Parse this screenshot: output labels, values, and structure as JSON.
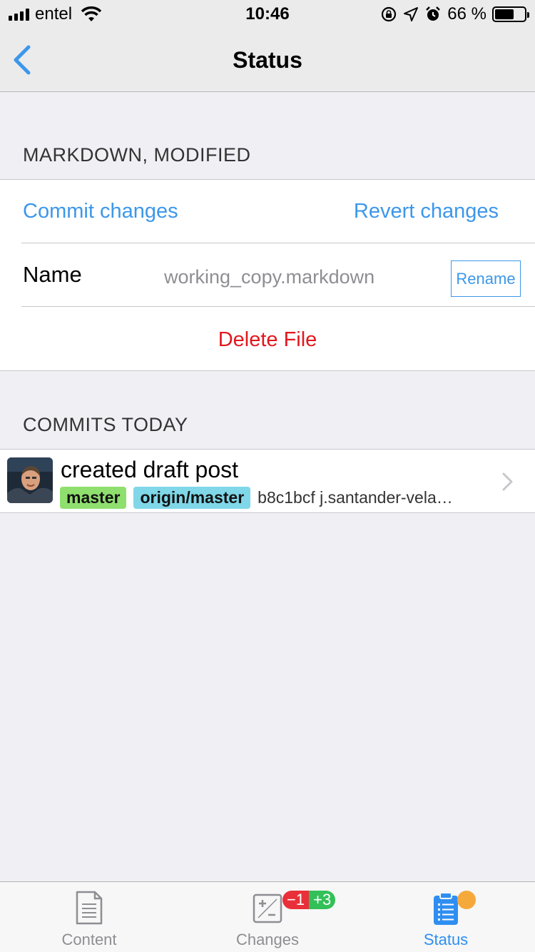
{
  "status_bar": {
    "carrier": "entel",
    "time": "10:46",
    "battery_text": "66 %",
    "battery_level": 0.66
  },
  "nav": {
    "title": "Status"
  },
  "file_section": {
    "header": "MARKDOWN, MODIFIED",
    "commit_label": "Commit changes",
    "revert_label": "Revert changes",
    "name_label": "Name",
    "name_value": "working_copy.markdown",
    "rename_label": "Rename",
    "delete_label": "Delete File"
  },
  "commits_section": {
    "header": "COMMITS TODAY",
    "commits": [
      {
        "title": "created draft post",
        "branch_tags": [
          "master",
          "origin/master"
        ],
        "meta": "b8c1bcf j.santander-vela…"
      }
    ]
  },
  "tabbar": {
    "tabs": [
      {
        "label": "Content",
        "icon": "document-icon",
        "active": false
      },
      {
        "label": "Changes",
        "icon": "diff-icon",
        "active": false,
        "badge_minus": "−1",
        "badge_plus": "+3"
      },
      {
        "label": "Status",
        "icon": "clipboard-list-icon",
        "active": true
      }
    ]
  },
  "colors": {
    "accent": "#3c97ea",
    "destructive": "#e3171e",
    "tag_master": "#8fdf6e",
    "tag_origin": "#7fd7e8",
    "badge_minus": "#e9303a",
    "badge_plus": "#33c058",
    "status_dot": "#f6a93b"
  }
}
